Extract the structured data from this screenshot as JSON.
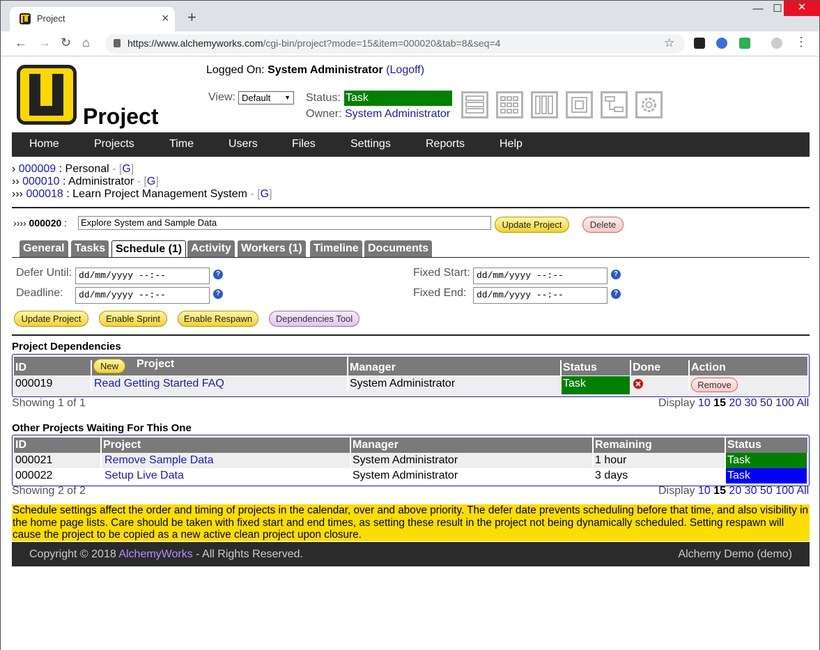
{
  "browser": {
    "tab_title": "Project",
    "url_host": "https://www.alchemyworks.com",
    "url_path": "/cgi-bin/project?mode=15&item=000020&tab=8&seq=4"
  },
  "header": {
    "app_title": "Project",
    "logged_label": "Logged On:",
    "user": "System Administrator",
    "logoff": "(Logoff)",
    "view_label": "View:",
    "view_value": "Default",
    "status_label": "Status:",
    "status_value": "Task",
    "status_color": "#008000",
    "owner_label": "Owner:",
    "owner_value": "System Administrator"
  },
  "nav": [
    "Home",
    "Projects",
    "Time",
    "Users",
    "Files",
    "Settings",
    "Reports",
    "Help"
  ],
  "breadcrumbs": [
    {
      "prefix": "›",
      "id": "000009",
      "name": "Personal",
      "g": "G"
    },
    {
      "prefix": "››",
      "id": "000010",
      "name": "Administrator",
      "g": "G"
    },
    {
      "prefix": "›››",
      "id": "000018",
      "name": "Learn Project Management System",
      "g": "G"
    }
  ],
  "project": {
    "prefix": "››››",
    "id": "000020",
    "title": "Explore System and Sample Data",
    "update": "Update Project",
    "delete": "Delete"
  },
  "tabs": [
    "General",
    "Tasks",
    "Schedule (1)",
    "Activity",
    "Workers (1)",
    "Timeline",
    "Documents"
  ],
  "schedule": {
    "defer_label": "Defer Until:",
    "deadline_label": "Deadline:",
    "fixed_start_label": "Fixed Start:",
    "fixed_end_label": "Fixed End:",
    "date_placeholder": "dd/mm/yyyy --:--",
    "help": "?"
  },
  "buttons": {
    "update": "Update Project",
    "sprint": "Enable Sprint",
    "respawn": "Enable Respawn",
    "deps": "Dependencies Tool"
  },
  "deps": {
    "title": "Project Dependencies",
    "new": "New",
    "headers": [
      "ID",
      "Project",
      "Manager",
      "Status",
      "Done",
      "Action"
    ],
    "rows": [
      {
        "id": "000019",
        "project": "Read Getting Started FAQ",
        "manager": "System Administrator",
        "status": "Task",
        "action": "Remove"
      }
    ],
    "showing": "Showing 1 of 1"
  },
  "display": {
    "label": "Display",
    "options": [
      "10",
      "15",
      "20",
      "30",
      "50",
      "100",
      "All"
    ],
    "current": "15"
  },
  "waiting": {
    "title": "Other Projects Waiting For This One",
    "headers": [
      "ID",
      "Project",
      "Manager",
      "Remaining",
      "Status"
    ],
    "rows": [
      {
        "id": "000021",
        "project": "Remove Sample Data",
        "manager": "System Administrator",
        "remaining": "1 hour",
        "status": "Task",
        "color": "#008000"
      },
      {
        "id": "000022",
        "project": "Setup Live Data",
        "manager": "System Administrator",
        "remaining": "3 days",
        "status": "Task",
        "color": "#0000ff"
      }
    ],
    "showing": "Showing 2 of 2"
  },
  "note": "Schedule settings affect the order and timing of projects in the calendar, over and above priority. The defer date prevents scheduling before that time, and also visibility in the home page lists. Care should be taken with fixed start and end times, as setting these result in the project not being dynamically scheduled. Setting respawn will cause the project to be copied as a new active clean project upon closure.",
  "footer": {
    "copyright": "Copyright © 2018",
    "brand": "AlchemyWorks",
    "rights": "- All Rights Reserved.",
    "right": "Alchemy Demo (demo)"
  }
}
